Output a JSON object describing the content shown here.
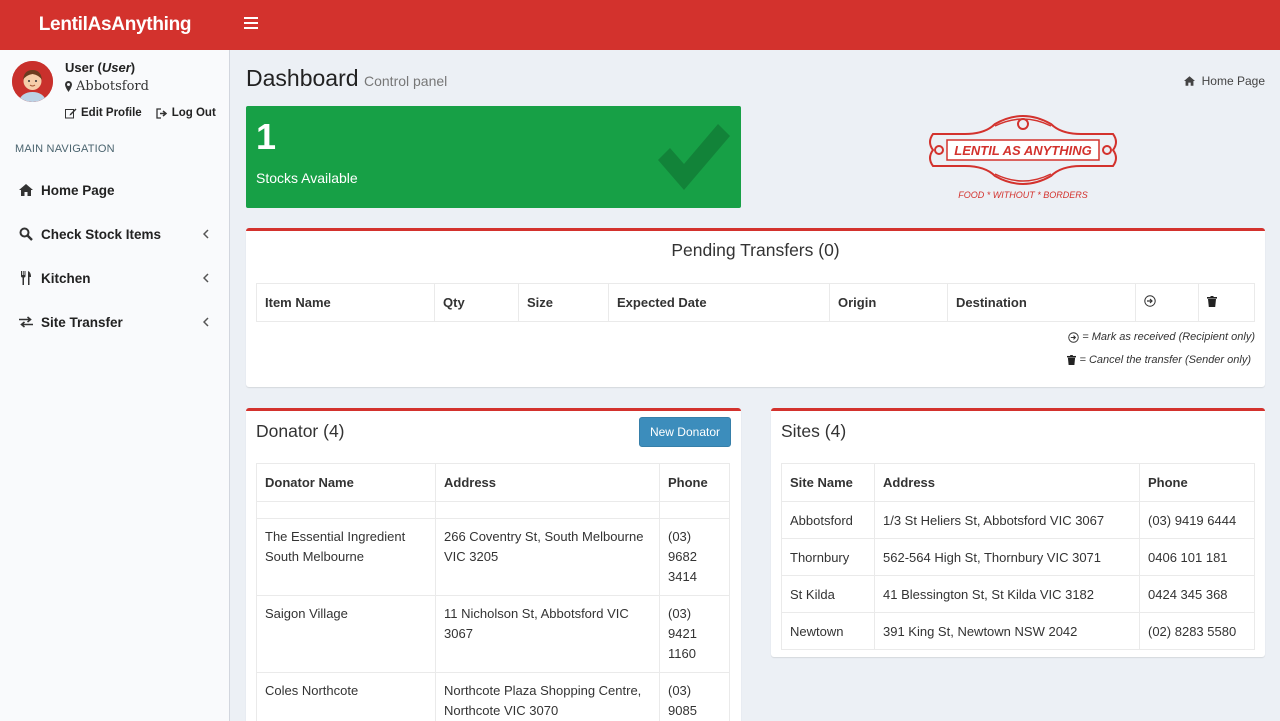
{
  "app": {
    "brand": "LentilAsAnything"
  },
  "user": {
    "name": "User",
    "role": "User",
    "location": "Abbotsford",
    "edit_profile": "Edit Profile",
    "log_out": "Log Out"
  },
  "nav": {
    "header": "MAIN NAVIGATION",
    "items": [
      {
        "label": "Home Page",
        "icon": "home-icon"
      },
      {
        "label": "Check Stock Items",
        "icon": "search-icon"
      },
      {
        "label": "Kitchen",
        "icon": "utensils-icon"
      },
      {
        "label": "Site Transfer",
        "icon": "exchange-icon"
      }
    ]
  },
  "page": {
    "title": "Dashboard",
    "subtitle": "Control panel",
    "breadcrumb": "Home Page"
  },
  "stat": {
    "value": "1",
    "label": "Stocks Available",
    "color": "#17a046"
  },
  "logo": {
    "main": "LENTIL AS ANYTHING",
    "tagline": "FOOD * WITHOUT * BORDERS"
  },
  "pending": {
    "title": "Pending Transfers (0)",
    "columns": [
      "Item Name",
      "Qty",
      "Size",
      "Expected Date",
      "Origin",
      "Destination"
    ],
    "legend_received": "= Mark as received (Recipient only)",
    "legend_cancel": "= Cancel the transfer (Sender only)"
  },
  "donator": {
    "title": "Donator (4)",
    "new_button": "New Donator",
    "columns": [
      "Donator Name",
      "Address",
      "Phone"
    ],
    "rows": [
      {
        "name": "The Essential Ingredient South Melbourne",
        "address": "266 Coventry St, South Melbourne VIC 3205",
        "phone": "(03) 9682 3414"
      },
      {
        "name": "Saigon Village",
        "address": "11 Nicholson St, Abbotsford VIC 3067",
        "phone": "(03) 9421 1160"
      },
      {
        "name": "Coles Northcote",
        "address": "Northcote Plaza Shopping Centre, Northcote VIC 3070",
        "phone": "(03) 9085"
      }
    ]
  },
  "sites": {
    "title": "Sites (4)",
    "columns": [
      "Site Name",
      "Address",
      "Phone"
    ],
    "rows": [
      {
        "name": "Abbotsford",
        "address": "1/3 St Heliers St, Abbotsford VIC 3067",
        "phone": "(03) 9419 6444"
      },
      {
        "name": "Thornbury",
        "address": "562-564 High St, Thornbury VIC 3071",
        "phone": "0406 101 181"
      },
      {
        "name": "St Kilda",
        "address": "41 Blessington St, St Kilda VIC 3182",
        "phone": "0424 345 368"
      },
      {
        "name": "Newtown",
        "address": "391 King St, Newtown NSW 2042",
        "phone": "(02) 8283 5580"
      }
    ]
  },
  "colors": {
    "brand_red": "#d3322d",
    "button_blue": "#3c8dbc"
  }
}
